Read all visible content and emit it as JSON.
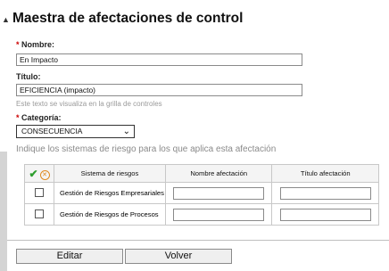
{
  "page": {
    "title": "Maestra de afectaciones de control"
  },
  "form": {
    "nombre": {
      "label": "Nombre:",
      "value": "En Impacto"
    },
    "titulo": {
      "label": "Título:",
      "value": "EFICIENCIA (impacto)",
      "hint": "Este texto se visualiza en la grilla de controles"
    },
    "categoria": {
      "label": "Categoría:",
      "value": "CONSECUENCIA"
    },
    "required_mark": "*"
  },
  "systems": {
    "instructions": "Indique los sistemas de riesgo para los que aplica esta afectación",
    "columns": [
      "Sistema de riesgos",
      "Nombre afectación",
      "Título afectación"
    ],
    "select_all_glyph": "✔",
    "clear_all_glyph": "✕",
    "rows": [
      {
        "name": "Gestión de Riesgos Empresariales",
        "checked": false,
        "nombre": "",
        "titulo": ""
      },
      {
        "name": "Gestión de Riesgos de Procesos",
        "checked": false,
        "nombre": "",
        "titulo": ""
      }
    ]
  },
  "actions": {
    "edit_label": "Editar",
    "back_label": "Volver"
  },
  "icons": {
    "collapse": "triangle-up-icon",
    "dropdown": "chevron-down-icon",
    "select_all": "check-icon",
    "clear_all": "x-circle-icon"
  },
  "colors": {
    "accent_green": "#2e9e2e",
    "accent_orange": "#e08a20",
    "required_red": "#cc0000"
  }
}
